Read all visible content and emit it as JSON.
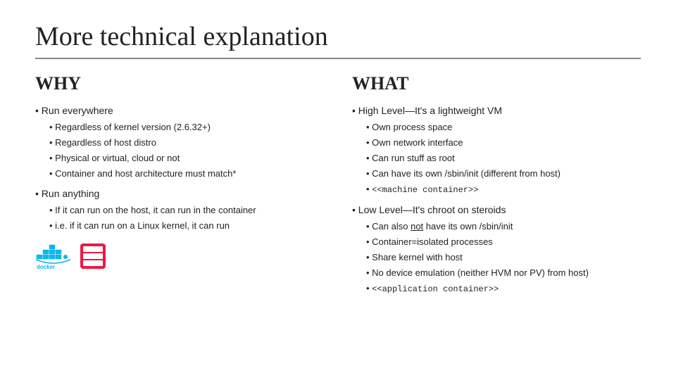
{
  "title": "More technical explanation",
  "why": {
    "heading": "WHY",
    "sections": [
      {
        "label": "Run everywhere",
        "sub": [
          {
            "label": "Regardless of kernel version (2.6.32+)"
          },
          {
            "label": "Regardless of host distro"
          },
          {
            "label": "Physical or virtual, cloud or not"
          },
          {
            "label": "Container and host architecture must match*"
          }
        ]
      },
      {
        "label": "Run anything",
        "sub": [
          {
            "label": "If it can run on the host, it can run in the container"
          },
          {
            "label": "i.e. if it can run on a Linux kernel, it can run"
          }
        ]
      }
    ]
  },
  "what": {
    "heading": "WHAT",
    "sections": [
      {
        "label": "High Level—It's a lightweight VM",
        "sub": [
          {
            "label": "Own process space"
          },
          {
            "label": "Own network interface"
          },
          {
            "label": "Can run stuff as root"
          },
          {
            "label": "Can have its own /sbin/init (different from host)"
          }
        ],
        "note": "<<machine container>>"
      },
      {
        "label": "Low Level—It's chroot on steroids",
        "sub": [
          {
            "label": "Can also not have its own /sbin/init",
            "not": "not"
          },
          {
            "label": "Container=isolated processes"
          },
          {
            "label": "Share kernel with host"
          },
          {
            "label": "No device emulation (neither HVM nor PV) from host)"
          }
        ],
        "note": "<<application container>>"
      }
    ]
  }
}
